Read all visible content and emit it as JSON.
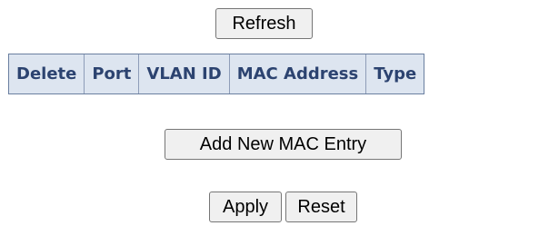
{
  "toolbar": {
    "refresh_label": "Refresh"
  },
  "mac_table": {
    "columns": [
      "Delete",
      "Port",
      "VLAN ID",
      "MAC Address",
      "Type"
    ]
  },
  "actions": {
    "add_label": "Add New MAC Entry",
    "apply_label": "Apply",
    "reset_label": "Reset"
  }
}
